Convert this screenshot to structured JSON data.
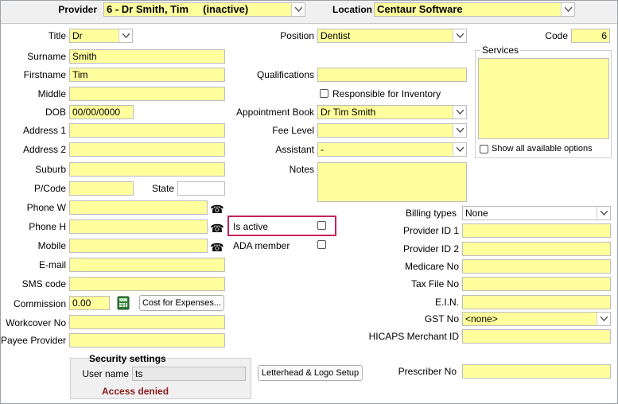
{
  "header": {
    "provider_label": "Provider",
    "provider_value": "6 - Dr Smith, Tim     (inactive)",
    "location_label": "Location",
    "location_value": "Centaur Software"
  },
  "left": {
    "title_label": "Title",
    "title_value": "Dr",
    "surname_label": "Surname",
    "surname_value": "Smith",
    "firstname_label": "Firstname",
    "firstname_value": "Tim",
    "middle_label": "Middle",
    "middle_value": "",
    "dob_label": "DOB",
    "dob_value": "00/00/0000",
    "address1_label": "Address 1",
    "address1_value": "",
    "address2_label": "Address 2",
    "address2_value": "",
    "suburb_label": "Suburb",
    "suburb_value": "",
    "pcode_label": "P/Code",
    "pcode_value": "",
    "state_label": "State",
    "state_value": "",
    "phonew_label": "Phone W",
    "phonew_value": "",
    "phoneh_label": "Phone H",
    "phoneh_value": "",
    "mobile_label": "Mobile",
    "mobile_value": "",
    "email_label": "E-mail",
    "email_value": "",
    "sms_label": "SMS code",
    "sms_value": "",
    "commission_label": "Commission",
    "commission_value": "0.00",
    "cost_button": "Cost for Expenses...",
    "workcover_label": "Workcover No",
    "workcover_value": "",
    "payee_label": "Payee Provider",
    "payee_value": ""
  },
  "security": {
    "title": "Security settings",
    "username_label": "User name",
    "username_value": "ts",
    "access_text": "Access denied"
  },
  "middle": {
    "position_label": "Position",
    "position_value": "Dentist",
    "qualifications_label": "Qualifications",
    "qualifications_value": "",
    "responsible_label": "Responsible for Inventory",
    "apptbook_label": "Appointment Book",
    "apptbook_value": "Dr Tim Smith",
    "feelevel_label": "Fee Level",
    "feelevel_value": "",
    "assistant_label": "Assistant",
    "assistant_value": "-",
    "notes_label": "Notes",
    "notes_value": "",
    "isactive_label": "Is active",
    "ada_label": "ADA member",
    "letterhead_button": "Letterhead & Logo Setup"
  },
  "right": {
    "code_label": "Code",
    "code_value": "6",
    "services_title": "Services",
    "show_all_label": "Show all available options",
    "billing_label": "Billing types",
    "billing_value": "None",
    "pid1_label": "Provider ID 1",
    "pid1_value": "",
    "pid2_label": "Provider ID 2",
    "pid2_value": "",
    "medicare_label": "Medicare No",
    "medicare_value": "",
    "taxfile_label": "Tax File No",
    "taxfile_value": "",
    "ein_label": "E.I.N.",
    "ein_value": "",
    "gst_label": "GST No",
    "gst_value": "<none>",
    "hicaps_label": "HICAPS Merchant ID",
    "hicaps_value": "",
    "prescriber_label": "Prescriber No",
    "prescriber_value": ""
  },
  "colors": {
    "field_bg": "#ffff9d",
    "highlight": "#c8225b",
    "access_denied": "#8b1a1a"
  }
}
